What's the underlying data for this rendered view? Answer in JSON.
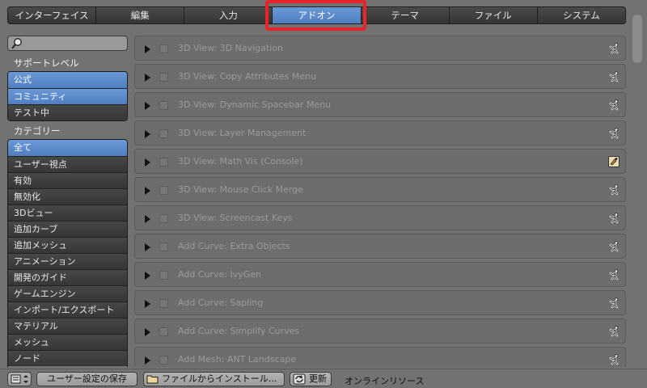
{
  "tabs": [
    {
      "label": "インターフェイス",
      "active": false
    },
    {
      "label": "編集",
      "active": false
    },
    {
      "label": "入力",
      "active": false
    },
    {
      "label": "アドオン",
      "active": true
    },
    {
      "label": "テーマ",
      "active": false
    },
    {
      "label": "ファイル",
      "active": false
    },
    {
      "label": "システム",
      "active": false
    }
  ],
  "sidebar": {
    "search_value": "",
    "support_level_label": "サポートレベル",
    "support_levels": [
      {
        "label": "公式",
        "active": true
      },
      {
        "label": "コミュニティ",
        "active": true
      },
      {
        "label": "テスト中",
        "active": false
      }
    ],
    "category_label": "カテゴリー",
    "categories": [
      {
        "label": "全て",
        "active": true
      },
      {
        "label": "ユーザー視点",
        "active": false
      },
      {
        "label": "有効",
        "active": false
      },
      {
        "label": "無効化",
        "active": false
      },
      {
        "label": "3Dビュー",
        "active": false
      },
      {
        "label": "追加カーブ",
        "active": false
      },
      {
        "label": "追加メッシュ",
        "active": false
      },
      {
        "label": "アニメーション",
        "active": false
      },
      {
        "label": "開発のガイド",
        "active": false
      },
      {
        "label": "ゲームエンジン",
        "active": false
      },
      {
        "label": "インポート/エクスポート",
        "active": false
      },
      {
        "label": "マテリアル",
        "active": false
      },
      {
        "label": "メッシュ",
        "active": false
      },
      {
        "label": "ノード",
        "active": false
      }
    ]
  },
  "addons": [
    {
      "name": "3D View: 3D Navigation",
      "icon": "community-icon"
    },
    {
      "name": "3D View: Copy Attributes Menu",
      "icon": "community-icon"
    },
    {
      "name": "3D View: Dynamic Spacebar Menu",
      "icon": "community-icon"
    },
    {
      "name": "3D View: Layer Management",
      "icon": "community-icon"
    },
    {
      "name": "3D View: Math Vis (Console)",
      "icon": "official-icon"
    },
    {
      "name": "3D View: Mouse Click Merge",
      "icon": "community-icon"
    },
    {
      "name": "3D View: Screencast Keys",
      "icon": "community-icon"
    },
    {
      "name": "Add Curve: Extra Objects",
      "icon": "community-icon"
    },
    {
      "name": "Add Curve: IvyGen",
      "icon": "community-icon"
    },
    {
      "name": "Add Curve: Sapling",
      "icon": "community-icon"
    },
    {
      "name": "Add Curve: Simplify Curves",
      "icon": "community-icon"
    },
    {
      "name": "Add Mesh: ANT Landscape",
      "icon": "community-icon"
    }
  ],
  "bottom": {
    "save_label": "ユーザー設定の保存",
    "install_label": "ファイルからインストール...",
    "refresh_label": "更新",
    "online_label": "オンラインリソース"
  },
  "colors": {
    "accent": "#5b8ccc",
    "highlight": "#e8232b"
  }
}
